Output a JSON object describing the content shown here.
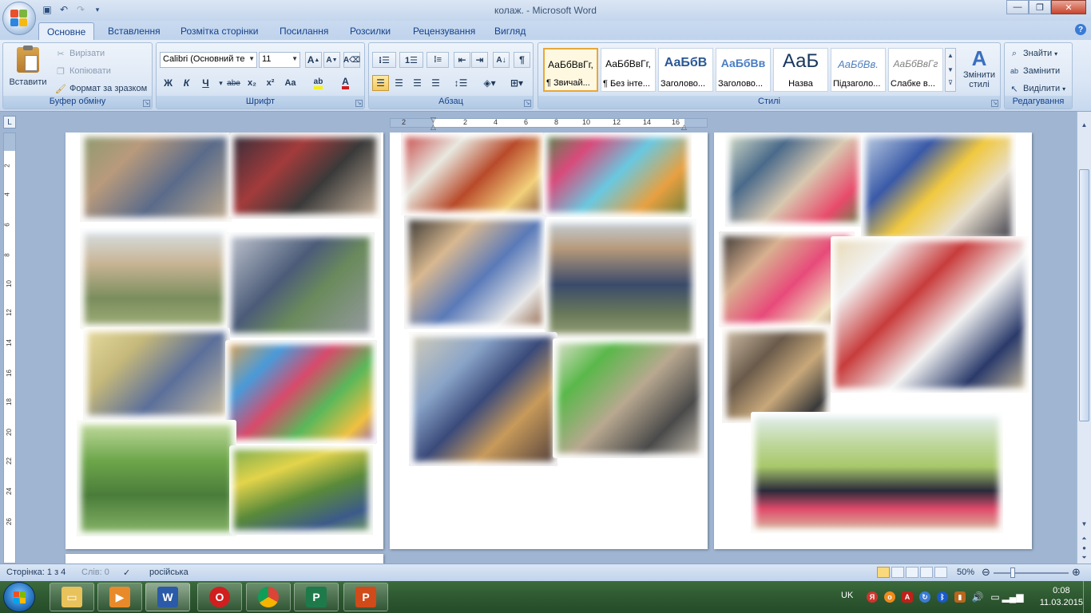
{
  "window": {
    "title": "колаж. - Microsoft Word"
  },
  "tabs": [
    "Основне",
    "Вставлення",
    "Розмітка сторінки",
    "Посилання",
    "Розсилки",
    "Рецензування",
    "Вигляд"
  ],
  "ribbon": {
    "clipboard": {
      "label": "Буфер обміну",
      "paste": "Вставити",
      "cut": "Вирізати",
      "copy": "Копіювати",
      "format_painter": "Формат за зразком"
    },
    "font": {
      "label": "Шрифт",
      "font_name": "Calibri (Основний те",
      "font_size": "11",
      "bold": "Ж",
      "italic": "К",
      "underline": "Ч",
      "strike": "abe",
      "subscript": "x₂",
      "superscript": "x²",
      "change_case": "Aa",
      "grow": "A",
      "shrink": "A"
    },
    "paragraph": {
      "label": "Абзац"
    },
    "styles": {
      "label": "Стилі",
      "items": [
        {
          "sample": "АаБбВвГг,",
          "name": "¶ Звичай..."
        },
        {
          "sample": "АаБбВвГг,",
          "name": "¶ Без інте..."
        },
        {
          "sample": "АаБбВ",
          "name": "Заголово..."
        },
        {
          "sample": "АаБбВв",
          "name": "Заголово..."
        },
        {
          "sample": "АаБ",
          "name": "Назва"
        },
        {
          "sample": "АаБбВв.",
          "name": "Підзаголо..."
        },
        {
          "sample": "АаБбВвГг",
          "name": "Слабке в..."
        }
      ],
      "change_styles": "Змінити стилі"
    },
    "editing": {
      "label": "Редагування",
      "find": "Знайти",
      "replace": "Замінити",
      "select": "Виділити"
    }
  },
  "ruler": {
    "h_numbers": [
      "2",
      "2",
      "4",
      "6",
      "8",
      "10",
      "12",
      "14",
      "16"
    ],
    "v_numbers": [
      "2",
      "4",
      "6",
      "8",
      "10",
      "12",
      "14",
      "16",
      "18",
      "20",
      "22",
      "24",
      "26"
    ]
  },
  "status": {
    "page": "Сторінка: 1 з 4",
    "words": "Слів: 0",
    "language": "російська",
    "zoom": "50%"
  },
  "taskbar": {
    "lang": "UK",
    "time": "0:08",
    "date": "11.03.2015"
  },
  "colors": {
    "accent": "#15428b",
    "ribbon_bg": "#dce7f5",
    "workspace_bg": "#9fb5d2",
    "taskbar_bg": "#2f5a32"
  }
}
